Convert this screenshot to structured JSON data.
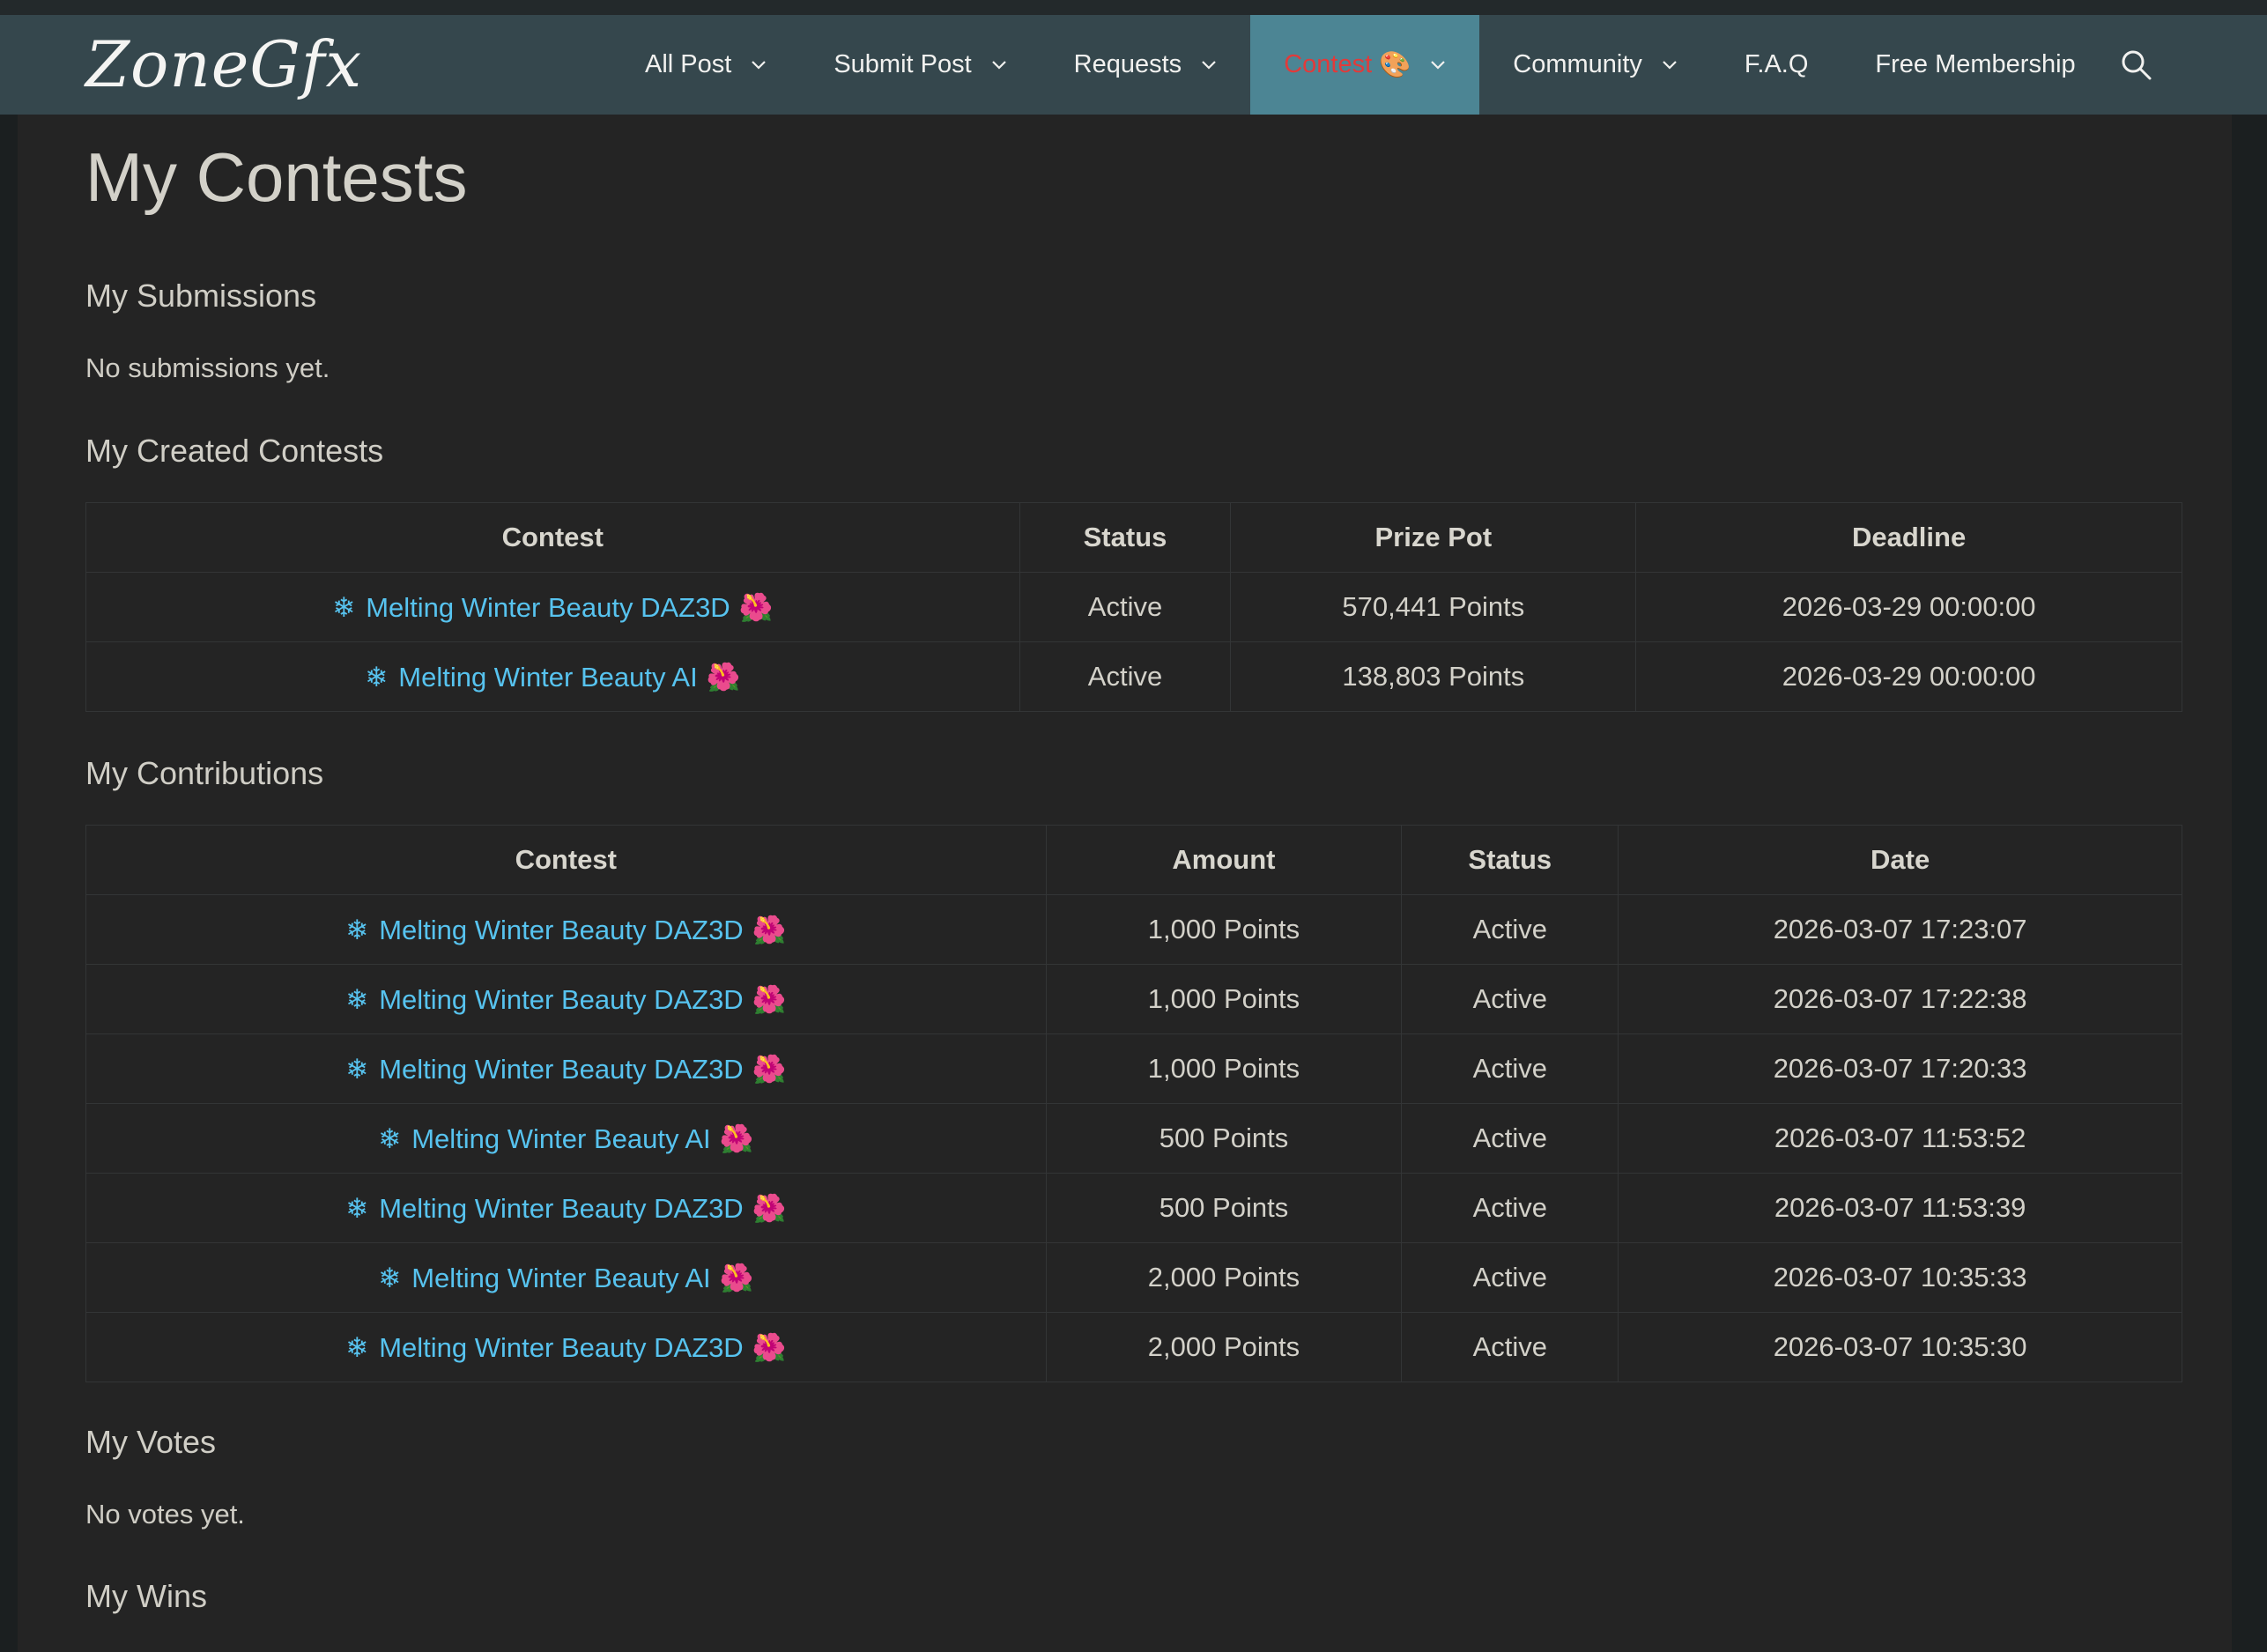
{
  "header": {
    "logo_text": "ZoneGfx",
    "nav": [
      {
        "label": "All Post",
        "has_dropdown": true
      },
      {
        "label": "Submit Post",
        "has_dropdown": true
      },
      {
        "label": "Requests",
        "has_dropdown": true
      },
      {
        "label": "Contest",
        "has_dropdown": true,
        "active": true,
        "emoji": "🎨"
      },
      {
        "label": "Community",
        "has_dropdown": true
      },
      {
        "label": "F.A.Q",
        "has_dropdown": false
      },
      {
        "label": "Free Membership",
        "has_dropdown": false
      }
    ],
    "search_icon": "search-icon",
    "colors": {
      "navbar": "#35474d",
      "active_tab": "#4c8594",
      "active_text": "#e23a3a"
    }
  },
  "page": {
    "title": "My Contests",
    "link_color": "#57c3ef"
  },
  "submissions": {
    "heading": "My Submissions",
    "empty_text": "No submissions yet."
  },
  "created_contests": {
    "heading": "My Created Contests",
    "columns": [
      "Contest",
      "Status",
      "Prize Pot",
      "Deadline"
    ],
    "rows": [
      {
        "contest": "Melting Winter Beauty DAZ3D",
        "status": "Active",
        "prize_pot": "570,441 Points",
        "deadline": "2026-03-29 00:00:00"
      },
      {
        "contest": "Melting Winter Beauty AI",
        "status": "Active",
        "prize_pot": "138,803 Points",
        "deadline": "2026-03-29 00:00:00"
      }
    ]
  },
  "contributions": {
    "heading": "My Contributions",
    "columns": [
      "Contest",
      "Amount",
      "Status",
      "Date"
    ],
    "rows": [
      {
        "contest": "Melting Winter Beauty DAZ3D",
        "amount": "1,000 Points",
        "status": "Active",
        "date": "2026-03-07 17:23:07"
      },
      {
        "contest": "Melting Winter Beauty DAZ3D",
        "amount": "1,000 Points",
        "status": "Active",
        "date": "2026-03-07 17:22:38"
      },
      {
        "contest": "Melting Winter Beauty DAZ3D",
        "amount": "1,000 Points",
        "status": "Active",
        "date": "2026-03-07 17:20:33"
      },
      {
        "contest": "Melting Winter Beauty AI",
        "amount": "500 Points",
        "status": "Active",
        "date": "2026-03-07 11:53:52"
      },
      {
        "contest": "Melting Winter Beauty DAZ3D",
        "amount": "500 Points",
        "status": "Active",
        "date": "2026-03-07 11:53:39"
      },
      {
        "contest": "Melting Winter Beauty AI",
        "amount": "2,000 Points",
        "status": "Active",
        "date": "2026-03-07 10:35:33"
      },
      {
        "contest": "Melting Winter Beauty DAZ3D",
        "amount": "2,000 Points",
        "status": "Active",
        "date": "2026-03-07 10:35:30"
      }
    ]
  },
  "votes": {
    "heading": "My Votes",
    "empty_text": "No votes yet."
  },
  "wins": {
    "heading": "My Wins"
  }
}
